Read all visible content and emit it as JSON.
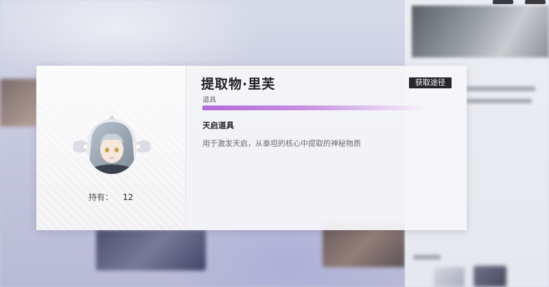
{
  "item": {
    "name": "提取物·里芙",
    "type": "道具",
    "section_title": "天启道具",
    "description": "用于激发天启，从泰坦的核心中提取的神秘物质",
    "hold_label": "持有：",
    "hold_count": "12",
    "rarity_color": "#b26ad8"
  },
  "actions": {
    "acquire_label": "获取途径"
  },
  "icons": {
    "portrait": "character-portrait-icon"
  }
}
